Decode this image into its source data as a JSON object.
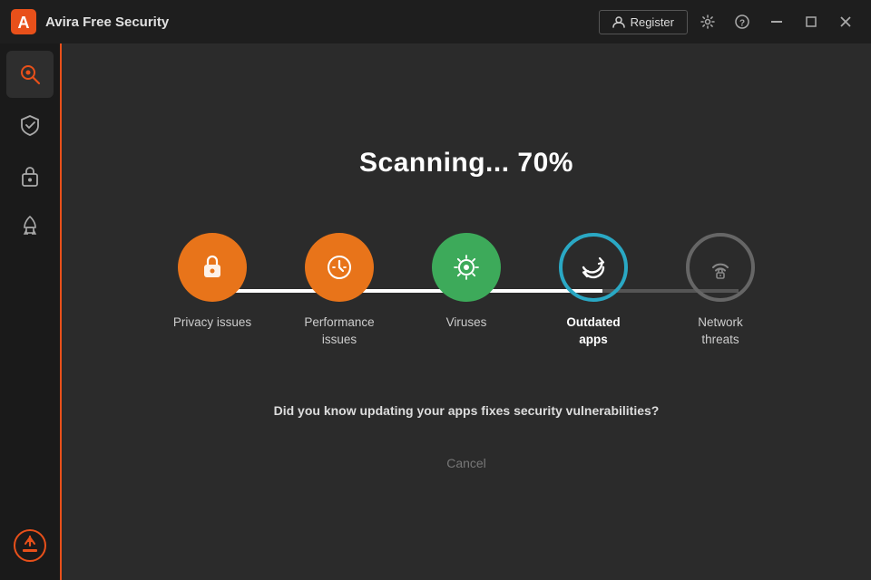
{
  "titlebar": {
    "logo_alt": "Avira logo",
    "title_part1": "Avira",
    "title_part2": "Free Security",
    "register_label": "Register",
    "settings_icon": "gear-icon",
    "help_icon": "help-icon",
    "minimize_icon": "minimize-icon",
    "maximize_icon": "maximize-icon",
    "close_icon": "close-icon"
  },
  "sidebar": {
    "items": [
      {
        "id": "scan",
        "label": "Scan",
        "active": true
      },
      {
        "id": "protection",
        "label": "Protection",
        "active": false
      },
      {
        "id": "privacy",
        "label": "Privacy",
        "active": false
      },
      {
        "id": "performance",
        "label": "Performance",
        "active": false
      }
    ],
    "bottom_item": {
      "id": "upgrade",
      "label": "Upgrade"
    }
  },
  "main": {
    "scan_title": "Scanning... 70%",
    "steps": [
      {
        "id": "privacy-issues",
        "label": "Privacy issues",
        "state": "done",
        "color": "orange",
        "icon": "lock"
      },
      {
        "id": "performance-issues",
        "label": "Performance issues",
        "state": "done",
        "color": "orange",
        "icon": "gauge"
      },
      {
        "id": "viruses",
        "label": "Viruses",
        "state": "done",
        "color": "green",
        "icon": "virus"
      },
      {
        "id": "outdated-apps",
        "label": "Outdated apps",
        "state": "active",
        "color": "teal",
        "icon": "refresh"
      },
      {
        "id": "network-threats",
        "label": "Network threats",
        "state": "pending",
        "color": "gray",
        "icon": "wifi-lock"
      }
    ],
    "progress_percent": 75,
    "tip_text": "Did you know updating your apps fixes security vulnerabilities?",
    "cancel_label": "Cancel"
  }
}
